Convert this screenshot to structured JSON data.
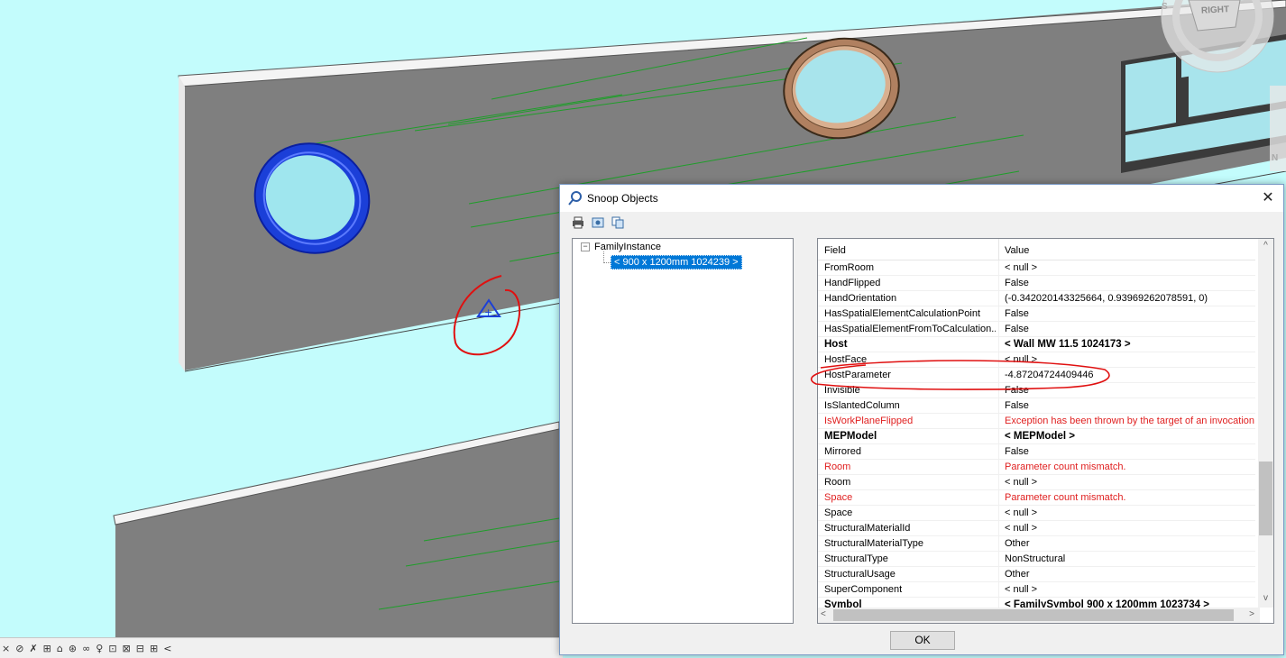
{
  "dialog": {
    "title": "Snoop Objects",
    "close_glyph": "✕",
    "ok_label": "OK",
    "toolbar_icons": [
      "print-icon",
      "print-preview-icon",
      "copy-icon"
    ]
  },
  "tree": {
    "toggle_glyph": "−",
    "root": "FamilyInstance",
    "child": "< 900 x 1200mm  1024239 >"
  },
  "grid": {
    "header_field": "Field",
    "header_value": "Value",
    "rows": [
      {
        "field": "FromRoom",
        "value": "< null >",
        "style": ""
      },
      {
        "field": "HandFlipped",
        "value": "False",
        "style": ""
      },
      {
        "field": "HandOrientation",
        "value": "(-0.342020143325664, 0.93969262078591, 0)",
        "style": ""
      },
      {
        "field": "HasSpatialElementCalculationPoint",
        "value": "False",
        "style": ""
      },
      {
        "field": "HasSpatialElementFromToCalculation...",
        "value": "False",
        "style": ""
      },
      {
        "field": "Host",
        "value": "< Wall  MW 11.5  1024173 >",
        "style": "bold"
      },
      {
        "field": "HostFace",
        "value": "< null >",
        "style": ""
      },
      {
        "field": "HostParameter",
        "value": "-4.87204724409446",
        "style": ""
      },
      {
        "field": "Invisible",
        "value": "False",
        "style": ""
      },
      {
        "field": "IsSlantedColumn",
        "value": "False",
        "style": ""
      },
      {
        "field": "IsWorkPlaneFlipped",
        "value": "Exception has been thrown by the target of an invocation.",
        "style": "err"
      },
      {
        "field": "MEPModel",
        "value": "< MEPModel >",
        "style": "bold"
      },
      {
        "field": "Mirrored",
        "value": "False",
        "style": ""
      },
      {
        "field": "Room",
        "value": "Parameter count mismatch.",
        "style": "err"
      },
      {
        "field": "Room",
        "value": "< null >",
        "style": ""
      },
      {
        "field": "Space",
        "value": "Parameter count mismatch.",
        "style": "err"
      },
      {
        "field": "Space",
        "value": "< null >",
        "style": ""
      },
      {
        "field": "StructuralMaterialId",
        "value": "< null >",
        "style": ""
      },
      {
        "field": "StructuralMaterialType",
        "value": "Other",
        "style": ""
      },
      {
        "field": "StructuralType",
        "value": "NonStructural",
        "style": ""
      },
      {
        "field": "StructuralUsage",
        "value": "Other",
        "style": ""
      },
      {
        "field": "SuperComponent",
        "value": "< null >",
        "style": ""
      },
      {
        "field": "Symbol",
        "value": "< FamilySymbol  900 x 1200mm  1023734 >",
        "style": "bold"
      }
    ],
    "scroll": {
      "up": "^",
      "down": "v",
      "left": "<",
      "right": ">"
    }
  },
  "viewcube": {
    "label": "RIGHT",
    "compass_letters": [
      "S",
      "N"
    ]
  },
  "view_bar": {
    "icons": [
      "×",
      "⊘",
      "✗",
      "⊞",
      "⌂",
      "⊛",
      "∞",
      "♀",
      "⊡",
      "⊠",
      "⊟",
      "⊞",
      "<"
    ]
  },
  "colors": {
    "background": "#c3fcfc",
    "wall": "#808080",
    "selection_blue": "#0078d7",
    "error_red": "#e02020",
    "annotation_red": "#e01010"
  }
}
